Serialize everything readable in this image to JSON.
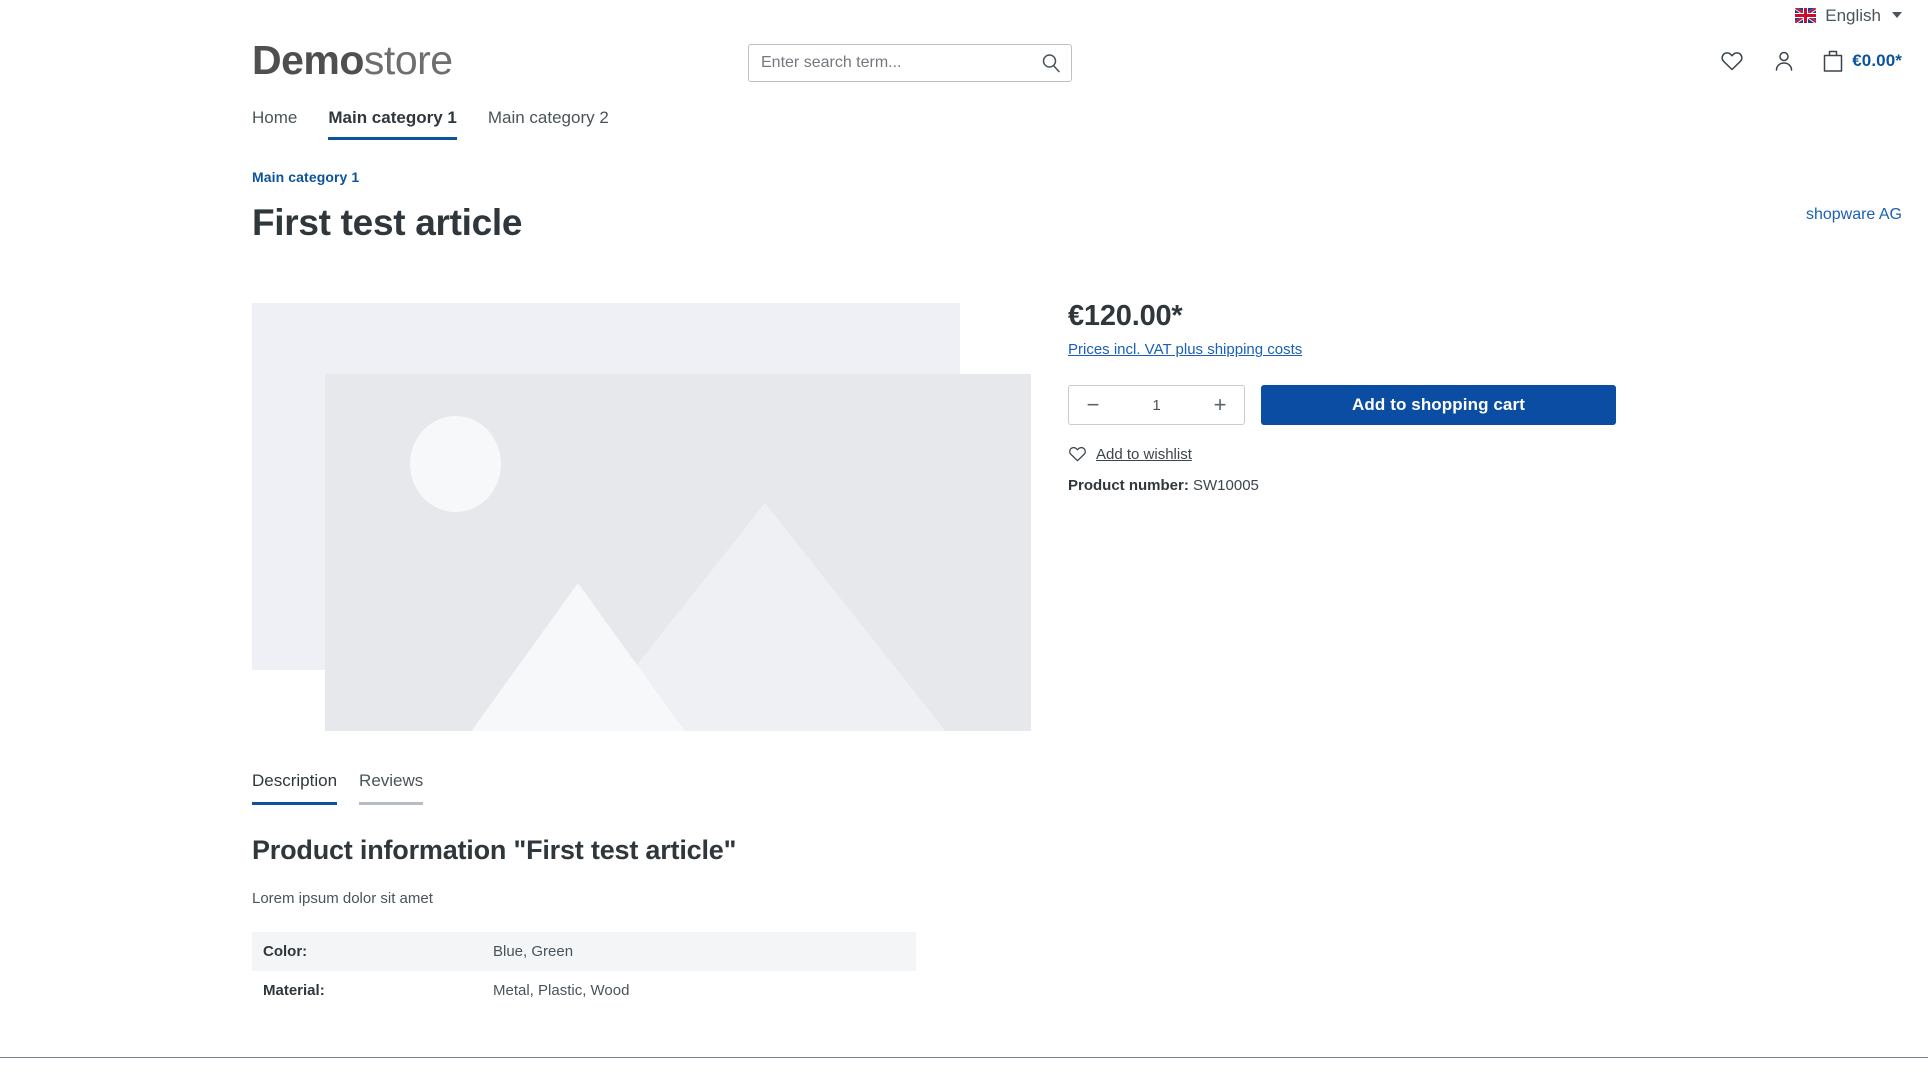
{
  "topbar": {
    "language": {
      "label": "English",
      "flag_icon": "uk-flag-icon",
      "caret_icon": "chevron-down-icon"
    }
  },
  "header": {
    "logo": {
      "bold_part": "Demo",
      "regular_part": "store"
    },
    "search": {
      "placeholder": "Enter search term...",
      "value": "",
      "icon": "search-icon"
    },
    "actions": {
      "wishlist_icon": "heart-icon",
      "account_icon": "user-icon",
      "cart_icon": "shopping-bag-icon",
      "cart_amount": "€0.00*"
    }
  },
  "nav": {
    "items": [
      {
        "label": "Home",
        "active": false
      },
      {
        "label": "Main category 1",
        "active": true
      },
      {
        "label": "Main category 2",
        "active": false
      }
    ]
  },
  "product": {
    "breadcrumb": "Main category 1",
    "title": "First test article",
    "manufacturer": "shopware AG",
    "price": "€120.00*",
    "tax_note": "Prices incl. VAT plus shipping costs",
    "quantity": "1",
    "decrease_label": "−",
    "increase_label": "+",
    "add_to_cart_label": "Add to shopping cart",
    "wishlist_label": "Add to wishlist",
    "product_number_label": "Product number:",
    "product_number_value": "SW10005",
    "gallery_placeholder_icon": "image-placeholder-icon"
  },
  "tabs": [
    {
      "label": "Description",
      "active": true
    },
    {
      "label": "Reviews",
      "active": false
    }
  ],
  "description": {
    "heading": "Product information \"First test article\"",
    "body": "Lorem ipsum dolor sit amet",
    "properties": [
      {
        "key": "Color:",
        "value": "Blue, Green"
      },
      {
        "key": "Material:",
        "value": "Metal, Plastic, Wood"
      }
    ]
  },
  "colors": {
    "brand_blue": "#0b4da2",
    "link_blue": "#1a5fb8",
    "breadcrumb_blue": "#0b539b",
    "text_dark": "#30373c",
    "text_body": "#4a545b",
    "placeholder_back": "#eff0f5",
    "placeholder_front": "#e6e8ec"
  }
}
